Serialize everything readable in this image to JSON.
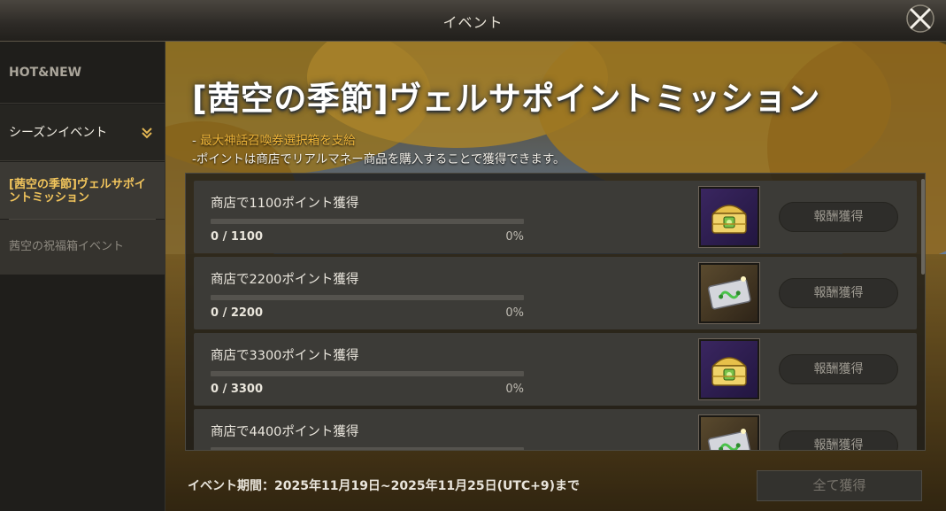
{
  "window": {
    "title": "イベント"
  },
  "sidebar": {
    "hot_label": "HOT&NEW",
    "season_label": "シーズンイベント",
    "sub_items": [
      {
        "label": "[茜空の季節]ヴェルサポイントミッション",
        "active": true
      },
      {
        "label": "茜空の祝福箱イベント",
        "active": false
      }
    ]
  },
  "event": {
    "title": "[茜空の季節]ヴェルサポイントミッション",
    "desc_dash": "- ",
    "desc_highlight": "最大神話召喚券選択箱を支給",
    "desc_main": "-ポイントは商店でリアルマネー商品を購入することで獲得できます。",
    "period": "イベント期間：2025年11月19日~2025年11月25日(UTC+9)まで",
    "claim_all_label": "全て獲得"
  },
  "missions": [
    {
      "label": "商店で1100ポイント獲得",
      "count": "0 / 1100",
      "percent": "0%",
      "progress": 0,
      "reward_icon": "golden-chest-icon",
      "button": "報酬獲得"
    },
    {
      "label": "商店で2200ポイント獲得",
      "count": "0 / 2200",
      "percent": "0%",
      "progress": 0,
      "reward_icon": "summon-ticket-icon",
      "button": "報酬獲得"
    },
    {
      "label": "商店で3300ポイント獲得",
      "count": "0 / 3300",
      "percent": "0%",
      "progress": 0,
      "reward_icon": "golden-chest-icon",
      "button": "報酬獲得"
    },
    {
      "label": "商店で4400ポイント獲得",
      "count": "",
      "percent": "",
      "progress": 0,
      "reward_icon": "summon-ticket-icon",
      "button": "報酬獲得"
    }
  ],
  "colors": {
    "accent": "#f0b63a",
    "active_menu": "#f2c55c",
    "panel": "#3c3b37"
  }
}
